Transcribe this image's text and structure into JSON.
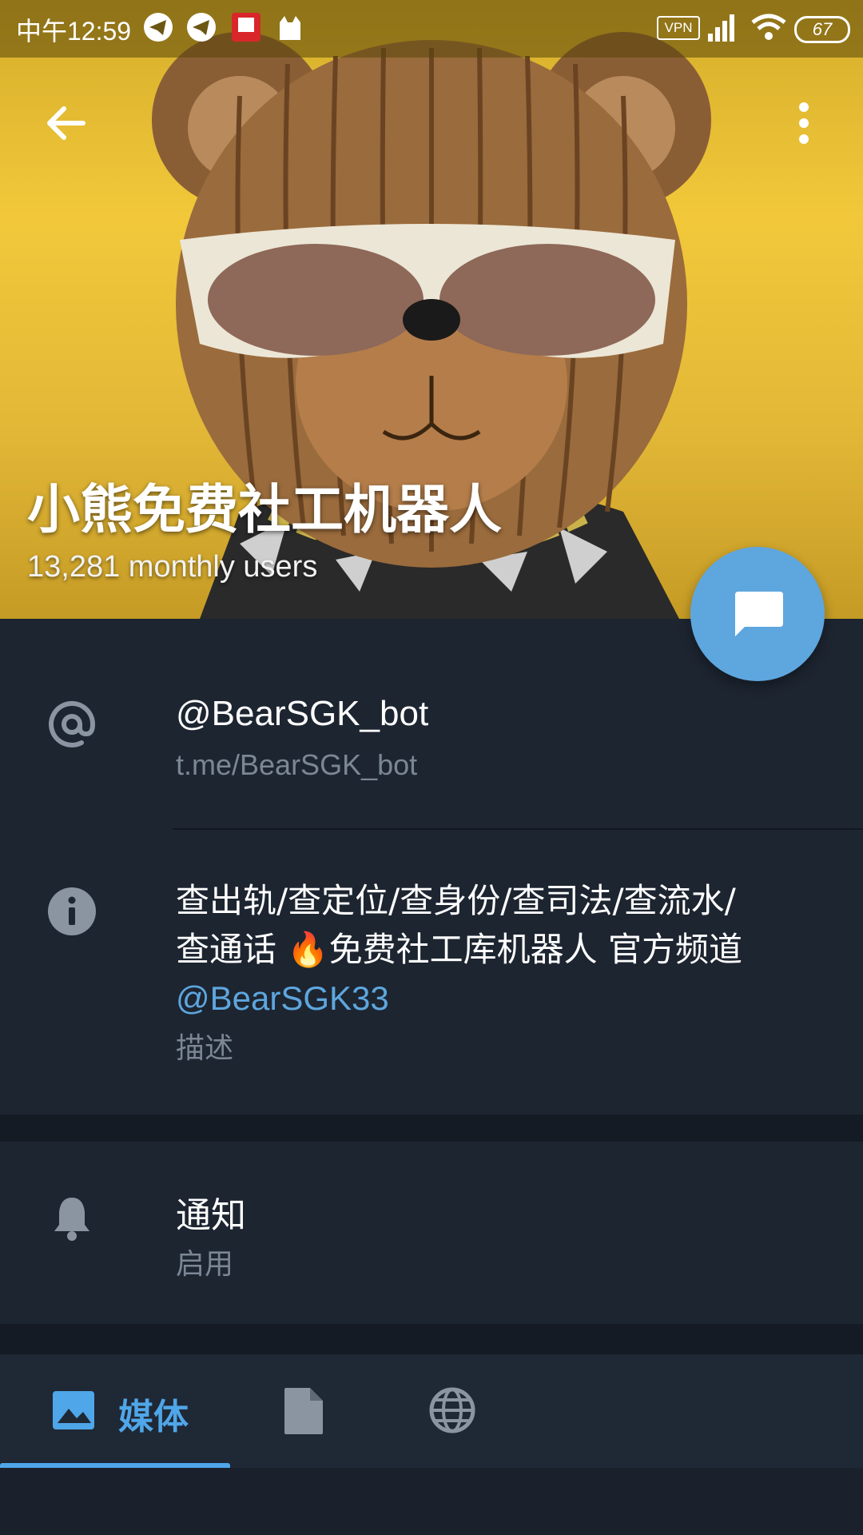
{
  "status_bar": {
    "time": "中午12:59",
    "vpn_label": "VPN",
    "battery": "67"
  },
  "header": {
    "title": "小熊免费社工机器人",
    "subtitle": "13,281 monthly users"
  },
  "username_row": {
    "username": "@BearSGK_bot",
    "link": "t.me/BearSGK_bot"
  },
  "description_row": {
    "text_line1": "查出轨/查定位/查身份/查司法/查流水/",
    "text_line2": "查通话 🔥免费社工库机器人 官方频道",
    "channel": "@BearSGK33",
    "label": "描述"
  },
  "notifications_row": {
    "title": "通知",
    "value": "启用"
  },
  "tabs": {
    "media_label": "媒体"
  },
  "colors": {
    "background": "#1d2531",
    "accent": "#4fa6e8",
    "fab": "#5ea6de"
  }
}
